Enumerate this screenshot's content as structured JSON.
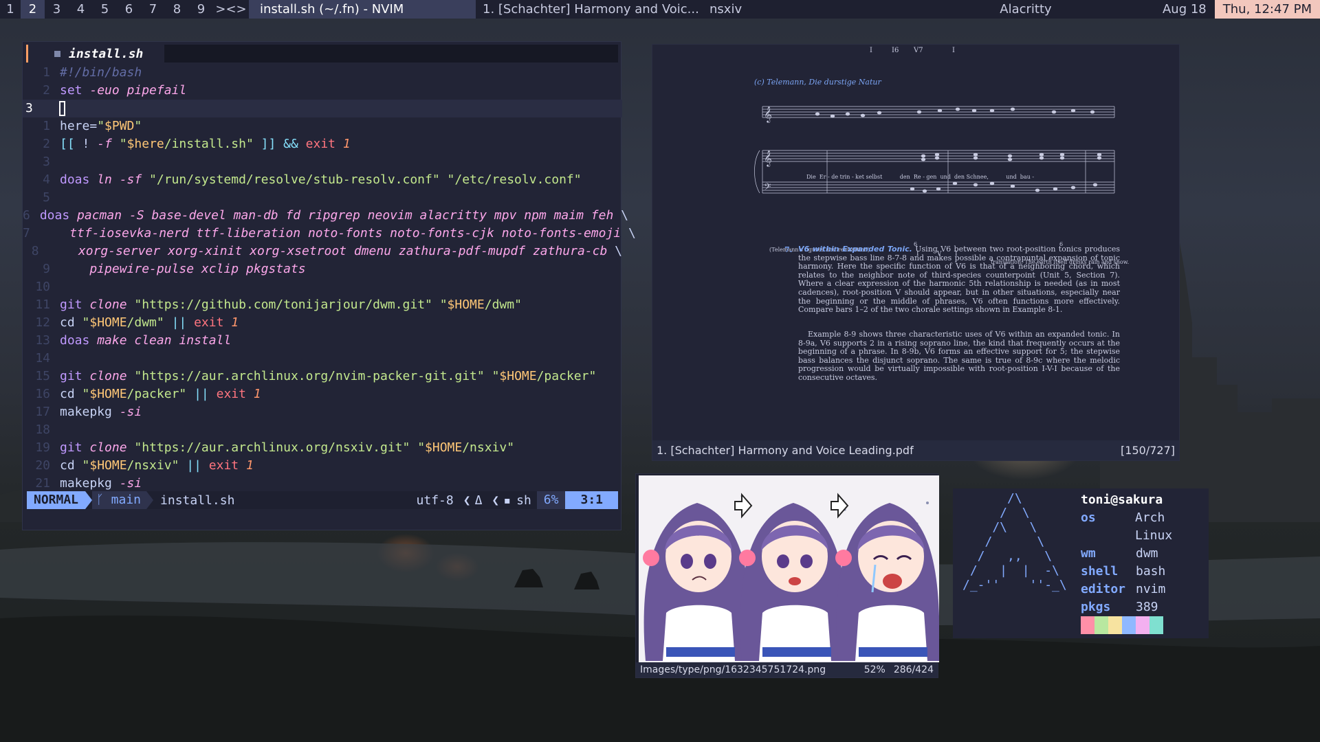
{
  "bar": {
    "tags": [
      "1",
      "2",
      "3",
      "4",
      "5",
      "6",
      "7",
      "8",
      "9"
    ],
    "active_tag": "2",
    "layout_symbol": "><>",
    "window_titles": [
      "install.sh (~/.fn) - NVIM",
      "1. [Schachter] Harmony and Voic...",
      "nsxiv",
      "Alacritty"
    ],
    "date": "Aug 18",
    "clock": "Thu, 12:47 PM"
  },
  "nvim": {
    "tab_filename": "install.sh",
    "lines": [
      {
        "n": "1",
        "segs": [
          {
            "t": "#!/bin/bash",
            "c": "com"
          }
        ]
      },
      {
        "n": "2",
        "segs": [
          {
            "t": "set ",
            "c": "cmd"
          },
          {
            "t": "-euo pipefail",
            "c": "it"
          }
        ]
      },
      {
        "n": "3",
        "cursor": true,
        "segs": []
      },
      {
        "n": "1",
        "segs": [
          {
            "t": "here=",
            "c": "fg"
          },
          {
            "t": "\"",
            "c": "str"
          },
          {
            "t": "$PWD",
            "c": "var"
          },
          {
            "t": "\"",
            "c": "str"
          }
        ]
      },
      {
        "n": "2",
        "segs": [
          {
            "t": "[[ ",
            "c": "op"
          },
          {
            "t": "! ",
            "c": "fg"
          },
          {
            "t": "-f ",
            "c": "it"
          },
          {
            "t": "\"",
            "c": "str"
          },
          {
            "t": "$here",
            "c": "var"
          },
          {
            "t": "/install.sh\"",
            "c": "str"
          },
          {
            "t": " ]] ",
            "c": "op"
          },
          {
            "t": "&& ",
            "c": "op"
          },
          {
            "t": "exit ",
            "c": "kw"
          },
          {
            "t": "1",
            "c": "num"
          }
        ]
      },
      {
        "n": "3",
        "segs": []
      },
      {
        "n": "4",
        "segs": [
          {
            "t": "doas ",
            "c": "cmd"
          },
          {
            "t": "ln -sf ",
            "c": "it"
          },
          {
            "t": "\"/run/systemd/resolve/stub-resolv.conf\" \"/etc/resolv.conf\"",
            "c": "str"
          }
        ]
      },
      {
        "n": "5",
        "segs": []
      },
      {
        "n": "6",
        "segs": [
          {
            "t": "doas ",
            "c": "cmd"
          },
          {
            "t": "pacman -S base-devel man-db fd ripgrep neovim alacritty mpv npm maim feh ",
            "c": "it"
          },
          {
            "t": "\\",
            "c": "fg"
          }
        ]
      },
      {
        "n": "7",
        "segs": [
          {
            "t": "    ttf-iosevka-nerd ttf-liberation noto-fonts noto-fonts-cjk noto-fonts-emoji ",
            "c": "it"
          },
          {
            "t": "\\",
            "c": "fg"
          }
        ]
      },
      {
        "n": "8",
        "segs": [
          {
            "t": "    xorg-server xorg-xinit xorg-xsetroot dmenu zathura-pdf-mupdf zathura-cb ",
            "c": "it"
          },
          {
            "t": "\\",
            "c": "fg"
          }
        ]
      },
      {
        "n": "9",
        "segs": [
          {
            "t": "    pipewire-pulse xclip pkgstats",
            "c": "it"
          }
        ]
      },
      {
        "n": "10",
        "segs": []
      },
      {
        "n": "11",
        "segs": [
          {
            "t": "git ",
            "c": "cmd"
          },
          {
            "t": "clone ",
            "c": "it"
          },
          {
            "t": "\"https://github.com/tonijarjour/dwm.git\" \"",
            "c": "str"
          },
          {
            "t": "$HOME",
            "c": "var"
          },
          {
            "t": "/dwm\"",
            "c": "str"
          }
        ]
      },
      {
        "n": "12",
        "segs": [
          {
            "t": "cd ",
            "c": "fg"
          },
          {
            "t": "\"",
            "c": "str"
          },
          {
            "t": "$HOME",
            "c": "var"
          },
          {
            "t": "/dwm\"",
            "c": "str"
          },
          {
            "t": " || ",
            "c": "op"
          },
          {
            "t": "exit ",
            "c": "kw"
          },
          {
            "t": "1",
            "c": "num"
          }
        ]
      },
      {
        "n": "13",
        "segs": [
          {
            "t": "doas ",
            "c": "cmd"
          },
          {
            "t": "make clean install",
            "c": "it"
          }
        ]
      },
      {
        "n": "14",
        "segs": []
      },
      {
        "n": "15",
        "segs": [
          {
            "t": "git ",
            "c": "cmd"
          },
          {
            "t": "clone ",
            "c": "it"
          },
          {
            "t": "\"https://aur.archlinux.org/nvim-packer-git.git\" \"",
            "c": "str"
          },
          {
            "t": "$HOME",
            "c": "var"
          },
          {
            "t": "/packer\"",
            "c": "str"
          }
        ]
      },
      {
        "n": "16",
        "segs": [
          {
            "t": "cd ",
            "c": "fg"
          },
          {
            "t": "\"",
            "c": "str"
          },
          {
            "t": "$HOME",
            "c": "var"
          },
          {
            "t": "/packer\"",
            "c": "str"
          },
          {
            "t": " || ",
            "c": "op"
          },
          {
            "t": "exit ",
            "c": "kw"
          },
          {
            "t": "1",
            "c": "num"
          }
        ]
      },
      {
        "n": "17",
        "segs": [
          {
            "t": "makepkg ",
            "c": "fg"
          },
          {
            "t": "-si",
            "c": "it"
          }
        ]
      },
      {
        "n": "18",
        "segs": []
      },
      {
        "n": "19",
        "segs": [
          {
            "t": "git ",
            "c": "cmd"
          },
          {
            "t": "clone ",
            "c": "it"
          },
          {
            "t": "\"https://aur.archlinux.org/nsxiv.git\" \"",
            "c": "str"
          },
          {
            "t": "$HOME",
            "c": "var"
          },
          {
            "t": "/nsxiv\"",
            "c": "str"
          }
        ]
      },
      {
        "n": "20",
        "segs": [
          {
            "t": "cd ",
            "c": "fg"
          },
          {
            "t": "\"",
            "c": "str"
          },
          {
            "t": "$HOME",
            "c": "var"
          },
          {
            "t": "/nsxiv\"",
            "c": "str"
          },
          {
            "t": " || ",
            "c": "op"
          },
          {
            "t": "exit ",
            "c": "kw"
          },
          {
            "t": "1",
            "c": "num"
          }
        ]
      },
      {
        "n": "21",
        "segs": [
          {
            "t": "makepkg ",
            "c": "fg"
          },
          {
            "t": "-si",
            "c": "it"
          }
        ]
      }
    ],
    "status": {
      "mode": "NORMAL",
      "branch": "main",
      "filename": "install.sh",
      "encoding": "utf-8",
      "format_icon": "Δ",
      "filetype": "sh",
      "percent": "6%",
      "position": "3:1"
    }
  },
  "zathura": {
    "status_filename": "1. [Schachter] Harmony and Voice Leading.pdf",
    "status_page": "[150/727]",
    "pdf": {
      "top_chords": [
        "I",
        "I6",
        "V7",
        "I"
      ],
      "example_caption": "(c) Telemann, Die durstige Natur",
      "lyrics": "Die  Er - de trin - ket selbst          den  Re - gen  und  den Schnee,          und  bau -",
      "bass_note": "(Telemann's figures and realization)",
      "bass_numerals": [
        "I",
        "V",
        "I"
      ],
      "bass_figures": [
        "6",
        "6"
      ],
      "translation": "translation: The earth itself drinks rain and snow.",
      "section_number": "7.",
      "section_heading": "V6 within Expanded Tonic.",
      "paragraph_1": "Using V6 between two root-position tonics produces the stepwise bass line 8-7-8 and makes possible a contrapuntal expansion of tonic harmony. Here the specific function of V6 is that of a neighboring chord, which relates to the neighbor note of third-species counterpoint (Unit 5, Section 7). Where a clear expression of the harmonic 5th relationship is needed (as in most cadences), root-position V should appear, but in other situations, especially near the beginning or the middle of phrases, V6 often functions more effectively. Compare bars 1–2 of the two chorale settings shown in Example 8-1.",
      "paragraph_2": "Example 8-9 shows three characteristic uses of V6 within an expanded tonic. In 8-9a, V6 supports 2 in a rising soprano line, the kind that frequently occurs at the beginning of a phrase. In 8-9b, V6 forms an effective support for 5; the stepwise bass balances the disjunct soprano. The same is true of 8-9c where the melodic progression would be virtually impossible with root-position I-V-I because of the consecutive octaves."
    }
  },
  "nsxiv": {
    "path": "Images/type/png/1632345751724.png",
    "zoom": "52%",
    "index": "286/424"
  },
  "fetch": {
    "ascii": "      /\\\n     /  \\\n    /\\   \\\n   /      \\\n  /   ,,   \\\n /   |  |  -\\\n/_-''    ''-_\\",
    "user": "toni@sakura",
    "rows": [
      {
        "key": "os",
        "value": "Arch Linux"
      },
      {
        "key": "wm",
        "value": "dwm"
      },
      {
        "key": "shell",
        "value": "bash"
      },
      {
        "key": "editor",
        "value": "nvim"
      },
      {
        "key": "pkgs",
        "value": "389"
      }
    ],
    "swatch_colors": [
      "#ff8fa8",
      "#b8e8a0",
      "#f7e3a0",
      "#8fb8ff",
      "#f3b0f0",
      "#7fe0d0"
    ]
  }
}
